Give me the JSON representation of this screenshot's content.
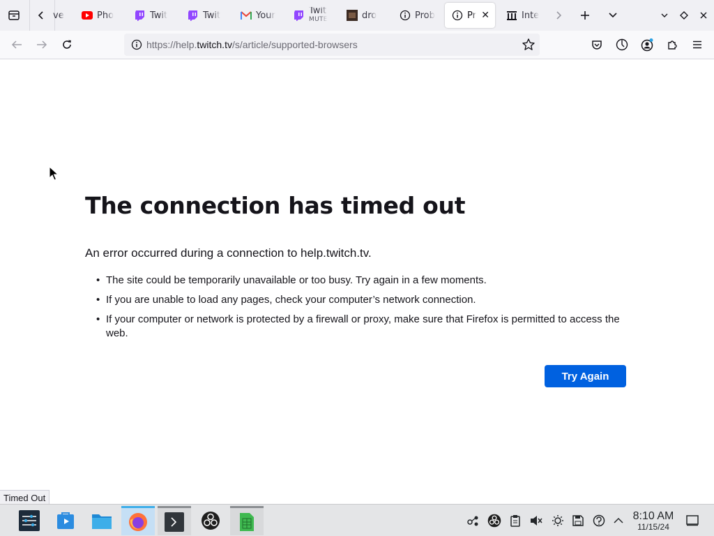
{
  "browser": {
    "tabs": [
      {
        "label": "ve",
        "icon": "generic-icon"
      },
      {
        "label": "Pho",
        "icon": "youtube-icon"
      },
      {
        "label": "Twit",
        "icon": "twitch-icon"
      },
      {
        "label": "Twit",
        "icon": "twitch-icon"
      },
      {
        "label": "Your",
        "icon": "gmail-icon"
      },
      {
        "label": "Twit",
        "sublabel": "MUTE",
        "icon": "twitch-icon"
      },
      {
        "label": "dro",
        "icon": "image-icon"
      },
      {
        "label": "Prob",
        "icon": "info-icon"
      },
      {
        "label": "Pr",
        "icon": "info-icon",
        "active": true
      },
      {
        "label": "Inte",
        "icon": "archive-icon"
      }
    ],
    "url_prefix": "https://help.",
    "url_domain": "twitch.tv",
    "url_path": "/s/article/supported-browsers"
  },
  "page": {
    "title": "The connection has timed out",
    "description": "An error occurred during a connection to help.twitch.tv.",
    "bullets": [
      "The site could be temporarily unavailable or too busy. Try again in a few moments.",
      "If you are unable to load any pages, check your computer’s network connection.",
      "If your computer or network is protected by a firewall or proxy, make sure that Firefox is permitted to access the web."
    ],
    "try_again_label": "Try Again",
    "status_text": "Timed Out"
  },
  "taskbar": {
    "time": "8:10 AM",
    "date": "11/15/24"
  },
  "colors": {
    "accent": "#0061e0",
    "twitch": "#9146ff",
    "youtube": "#ff0000"
  }
}
